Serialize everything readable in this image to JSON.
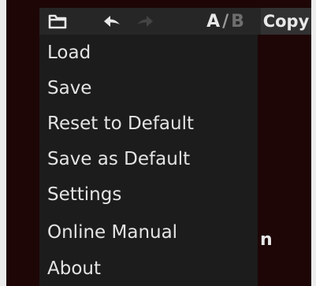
{
  "toolbar": {
    "folder_icon": "folder-icon",
    "undo_icon": "undo-arrow-icon",
    "redo_icon": "redo-arrow-icon",
    "ab": {
      "a": "A",
      "separator": "/",
      "b": "B"
    },
    "copy_label": "Copy"
  },
  "menu": {
    "items": [
      {
        "label": "Load"
      },
      {
        "label": "Save"
      },
      {
        "label": "Reset to Default"
      },
      {
        "label": "Save as Default"
      },
      {
        "label": "Settings"
      },
      {
        "label": "Online Manual"
      },
      {
        "label": "About"
      }
    ]
  },
  "background_text": "n",
  "colors": {
    "background": "#1e0606",
    "toolbar": "#262626",
    "menu": "#1c1c1c",
    "text": "#e4e4e4"
  }
}
